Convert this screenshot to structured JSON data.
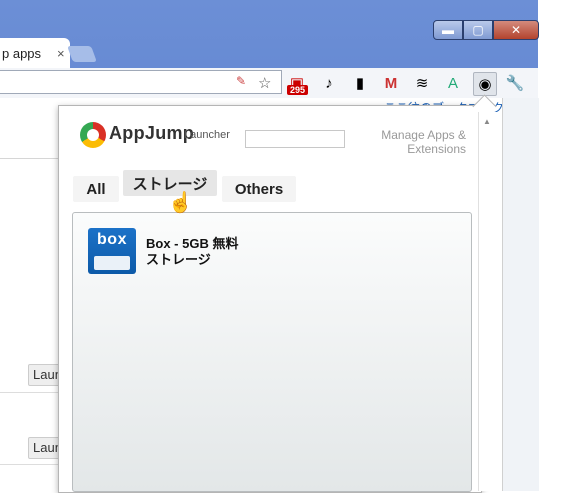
{
  "window": {
    "tab_title": "p apps",
    "tab_close": "×",
    "controls": {
      "minimize": "▬",
      "maximize": "▢",
      "close": "✕"
    }
  },
  "toolbar": {
    "icons": [
      "translate-icon",
      "star-icon",
      "calendar-icon",
      "lamp-icon",
      "notebook-icon",
      "gmail-icon",
      "buffer-icon",
      "translate-a-icon",
      "appjump-icon",
      "wrench-icon"
    ],
    "badge_count": "295"
  },
  "bookmarks_text": "ここ往のブックマーク",
  "background": {
    "launcher_label_1": "Laun",
    "launcher_label_2": "Laun"
  },
  "popup": {
    "brand": "AppJump",
    "brand_sub": "Launcher",
    "search_placeholder": "",
    "manage_link": "Manage Apps & Extensions",
    "tabs": [
      {
        "label": "All",
        "active": false
      },
      {
        "label": "ストレージ",
        "active": true
      },
      {
        "label": "Others",
        "active": false
      }
    ],
    "apps": [
      {
        "name": "Box - 5GB 無料",
        "name2": "ストレージ",
        "icon": "box-icon",
        "icon_text": "box"
      }
    ]
  },
  "colors": {
    "frame": "#5a7fcc",
    "link": "#1a5fb4"
  }
}
